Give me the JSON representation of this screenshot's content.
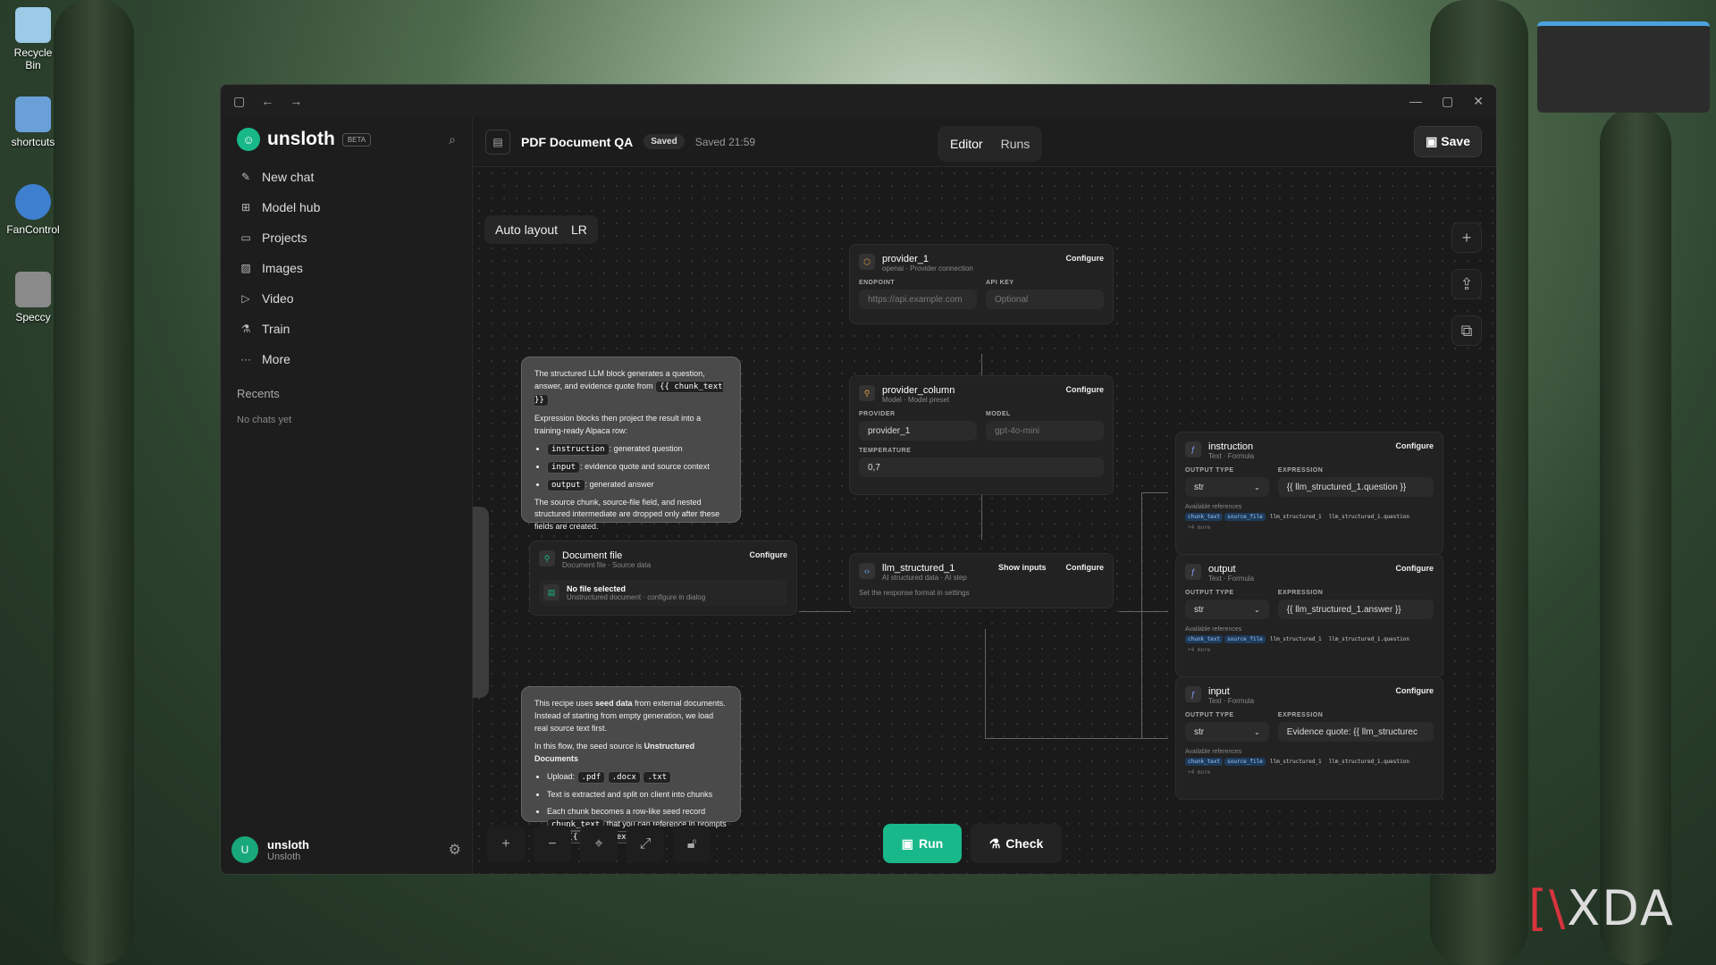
{
  "desktop": {
    "icons": [
      {
        "label": "Recycle Bin"
      },
      {
        "label": "shortcuts"
      },
      {
        "label": "FanControl"
      },
      {
        "label": "Speccy"
      }
    ],
    "watermark_bracket": "[\\",
    "watermark": "XDA"
  },
  "sidebar": {
    "brand": "unsloth",
    "beta": "BETA",
    "items": [
      {
        "label": "New chat",
        "icon": "✎"
      },
      {
        "label": "Model hub",
        "icon": "⊞"
      },
      {
        "label": "Projects",
        "icon": "▭"
      },
      {
        "label": "Images",
        "icon": "▨"
      },
      {
        "label": "Video",
        "icon": "▷"
      },
      {
        "label": "Train",
        "icon": "⚗"
      },
      {
        "label": "More",
        "icon": "···"
      }
    ],
    "recents_label": "Recents",
    "no_chats": "No chats yet",
    "user": {
      "initial": "U",
      "name": "unsloth",
      "sub": "Unsloth"
    }
  },
  "header": {
    "title": "PDF Document QA",
    "badge": "Saved",
    "saved_time": "Saved 21:59",
    "tab_editor": "Editor",
    "tab_runs": "Runs",
    "save": "Save"
  },
  "toolbar": {
    "auto_layout": "Auto layout",
    "direction": "LR"
  },
  "note1": {
    "p1a": "The structured LLM block generates a question, answer, and evidence quote from",
    "p1code": "{{ chunk_text }}",
    "p2": "Expression blocks then project the result into a training-ready Alpaca row:",
    "items": [
      {
        "code": "instruction",
        "text": ": generated question"
      },
      {
        "code": "input",
        "text": ": evidence quote and source context"
      },
      {
        "code": "output",
        "text": ": generated answer"
      }
    ],
    "p3": "The source chunk, source-file field, and nested structured intermediate are dropped only after these fields are created."
  },
  "note2": {
    "p1a": "This recipe uses",
    "p1b": "seed data",
    "p1c": "from external documents. Instead of starting from empty generation, we load real source text first.",
    "p2a": "In this flow, the seed source is",
    "p2b": "Unstructured Documents",
    "upload_label": "Upload:",
    "ext": [
      ".pdf",
      ".docx",
      ".txt"
    ],
    "li2": "Text is extracted and split on client into chunks",
    "li3a": "Each chunk becomes a row-like seed record",
    "li3code": "chunk_text",
    "li3b": "that you can reference in prompts with",
    "li3code2": "{{ chunk_text }}"
  },
  "provider": {
    "title": "provider_1",
    "sub": "openai · Provider connection",
    "configure": "Configure",
    "endpoint_label": "ENDPOINT",
    "endpoint_ph": "https://api.example.com",
    "apikey_label": "API KEY",
    "apikey_ph": "Optional"
  },
  "pcol": {
    "title": "provider_column",
    "sub": "Model · Model preset",
    "configure": "Configure",
    "provider_label": "PROVIDER",
    "provider_val": "provider_1",
    "model_label": "MODEL",
    "model_ph": "gpt-4o-mini",
    "temp_label": "TEMPERATURE",
    "temp_val": "0,7"
  },
  "docfile": {
    "title": "Document file",
    "sub": "Document file · Source data",
    "configure": "Configure",
    "nofile": "No file selected",
    "nofile_sub": "Unstructured document · configure in dialog"
  },
  "llm": {
    "title": "llm_structured_1",
    "sub": "AI structured data · AI step",
    "show_inputs": "Show inputs",
    "configure": "Configure",
    "hint": "Set the response format in settings"
  },
  "exprs": [
    {
      "title": "instruction",
      "sub": "Text · Formula",
      "configure": "Configure",
      "ot_label": "OUTPUT TYPE",
      "ot": "str",
      "ex_label": "EXPRESSION",
      "ex": "{{ llm_structured_1.question }}",
      "refs_label": "Available references",
      "chips": [
        "chunk_text",
        "source_file"
      ],
      "plain1": "llm_structured_1",
      "plain2": "llm_structured_1.question",
      "more": "+4 more"
    },
    {
      "title": "output",
      "sub": "Text · Formula",
      "configure": "Configure",
      "ot_label": "OUTPUT TYPE",
      "ot": "str",
      "ex_label": "EXPRESSION",
      "ex": "{{ llm_structured_1.answer }}",
      "refs_label": "Available references",
      "chips": [
        "chunk_text",
        "source_file"
      ],
      "plain1": "llm_structured_1",
      "plain2": "llm_structured_1.question",
      "more": "+4 more"
    },
    {
      "title": "input",
      "sub": "Text · Formula",
      "configure": "Configure",
      "ot_label": "OUTPUT TYPE",
      "ot": "str",
      "ex_label": "EXPRESSION",
      "ex": "Evidence quote: {{ llm_structurec",
      "refs_label": "Available references",
      "chips": [
        "chunk_text",
        "source_file"
      ],
      "plain1": "llm_structured_1",
      "plain2": "llm_structured_1.question",
      "more": "+4 more"
    }
  ],
  "actions": {
    "run": "Run",
    "check": "Check"
  }
}
